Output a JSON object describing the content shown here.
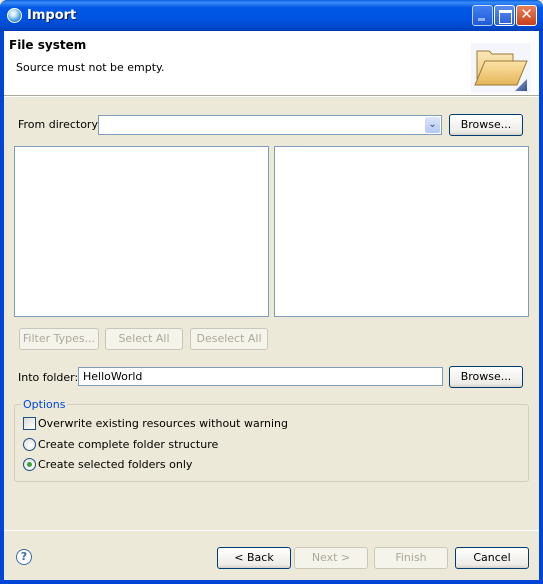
{
  "window": {
    "title": "Import",
    "controls": [
      "minimize",
      "maximize",
      "close"
    ]
  },
  "header": {
    "title": "File system",
    "message": "Source must not be empty.",
    "icon": "folder-open-icon"
  },
  "from_directory": {
    "label": "From directory:",
    "value": "",
    "browse_label": "Browse..."
  },
  "lists": {
    "left_items": [],
    "right_items": []
  },
  "selection_buttons": {
    "filter_types": "Filter Types...",
    "select_all": "Select All",
    "deselect_all": "Deselect All"
  },
  "into_folder": {
    "label": "Into folder:",
    "value": "HelloWorld",
    "browse_label": "Browse..."
  },
  "options": {
    "title": "Options",
    "overwrite": {
      "label": "Overwrite existing resources without warning",
      "checked": false
    },
    "create_complete": {
      "label": "Create complete folder structure",
      "selected": false
    },
    "create_selected": {
      "label": "Create selected folders only",
      "selected": true
    }
  },
  "footer": {
    "help_icon": "?",
    "back": "< Back",
    "next": "Next >",
    "finish": "Finish",
    "cancel": "Cancel"
  }
}
